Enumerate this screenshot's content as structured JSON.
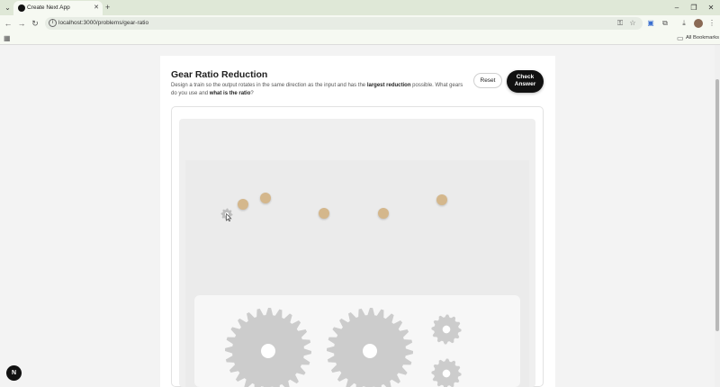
{
  "browser": {
    "tab_title": "Create Next App",
    "tab_close": "✕",
    "new_tab": "+",
    "url": "localhost:3000/problems/gear-ratio",
    "window_controls": {
      "minimize": "–",
      "restore": "❐",
      "close": "✕"
    },
    "bookmarks_label": "All Bookmarks",
    "nav": {
      "back": "←",
      "forward": "→",
      "reload": "↻"
    }
  },
  "problem": {
    "title": "Gear Ratio Reduction",
    "desc_part1": "Design a train so the output rotates in the same direction as the input and has the ",
    "desc_bold1": "largest reduction",
    "desc_part2": " possible. What gears do you use and ",
    "desc_bold2": "what is the ratio",
    "desc_part3": "?"
  },
  "actions": {
    "reset_label": "Reset",
    "check_line1": "Check",
    "check_line2": "Answer"
  },
  "canvas": {
    "peg_count": 5,
    "tray_gears": [
      "large-gear",
      "large-gear",
      "small-gear",
      "small-gear"
    ]
  },
  "dev_badge": "N",
  "colors": {
    "peg": "#d4b78c",
    "gear": "#cccccc",
    "primary_button": "#111111"
  }
}
